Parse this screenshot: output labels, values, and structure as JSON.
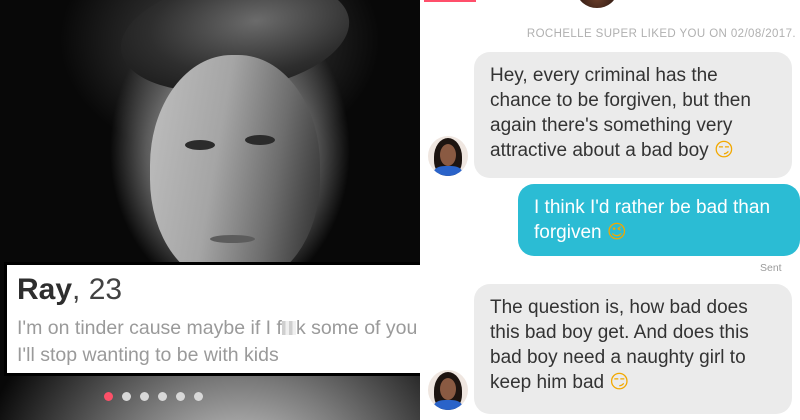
{
  "profile": {
    "name": "Ray",
    "age_text": ", 23",
    "bio_before": "I'm on tinder cause maybe if I f",
    "bio_after": "k some of you sluts I'll stop wanting to be with kids",
    "photo_dots": {
      "count": 6,
      "active_index": 0
    },
    "colors": {
      "active_dot": "#fd5068",
      "inactive_dot": "#d8d8d8"
    }
  },
  "chat": {
    "match_text": "ROCHELLE SUPER LIKED YOU ON 02/08/2017.",
    "messages": [
      {
        "from": "them",
        "text": "Hey, every criminal has the chance to be forgiven, but then again there's something very attractive about a bad boy",
        "emoji": "😏"
      },
      {
        "from": "me",
        "text": "I think I'd rather be bad than forgiven",
        "emoji": "😉"
      },
      {
        "from": "them",
        "text": "The question is, how bad does this bad boy get. And does this bad boy need a naughty girl to keep him bad",
        "emoji": "😏"
      }
    ],
    "sent_label": "Sent",
    "colors": {
      "outgoing": "#2bbcd4",
      "incoming": "#ebebeb",
      "brand": "#ff4f6b"
    }
  }
}
